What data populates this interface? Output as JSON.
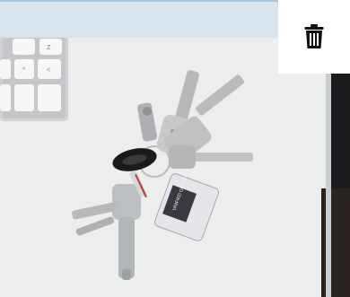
{
  "toolbar": {
    "delete_icon": "trash-icon"
  },
  "photo": {
    "card_text": "UNIFIED GROUP"
  },
  "colors": {
    "top_band": "#d8e4ec",
    "top_band_border": "#9fc3e6",
    "icon": "#111111",
    "button_bg": "#ffffff"
  }
}
